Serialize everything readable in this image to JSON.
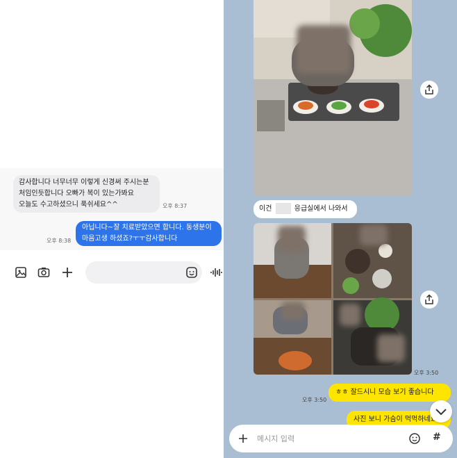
{
  "left_chat": {
    "incoming_message": "감사합니다    너무너무 이렇게 신경써 주시는분\n처임인듯합니다 오빠가 복이 있는가봐요\n오늘도 수고하셨으니 푹쉬세요^^",
    "incoming_time": "오후 8:37",
    "outgoing_message": "아닙니다~잘 치료받았으면 합니다. 동생분이\n마음고생 하셨죠?ㅜㅜ감사합니다",
    "outgoing_time": "오후 8:38",
    "toolbar": {
      "icons": [
        "image-icon",
        "camera-icon",
        "plus-icon",
        "emoji-icon",
        "voice-wave-icon"
      ]
    }
  },
  "right_chat": {
    "caption_before": "이건",
    "caption_after": "응급실에서 나와서",
    "photos_time": "오후 3:50",
    "reply_1": "ㅎㅎ 잘드시니 모습 보기 좋습니다",
    "reply_1_time": "오후 3:50",
    "reply_2": "사진 보니 가슴이 먹먹하네요",
    "input_placeholder": "메시지 입력",
    "hash_label": "#"
  },
  "colors": {
    "left_background": "#ffffff",
    "incoming_bubble": "#ececee",
    "outgoing_bubble": "#2d73ea",
    "right_background": "#a9bed2",
    "yellow_bubble": "#fee500"
  }
}
